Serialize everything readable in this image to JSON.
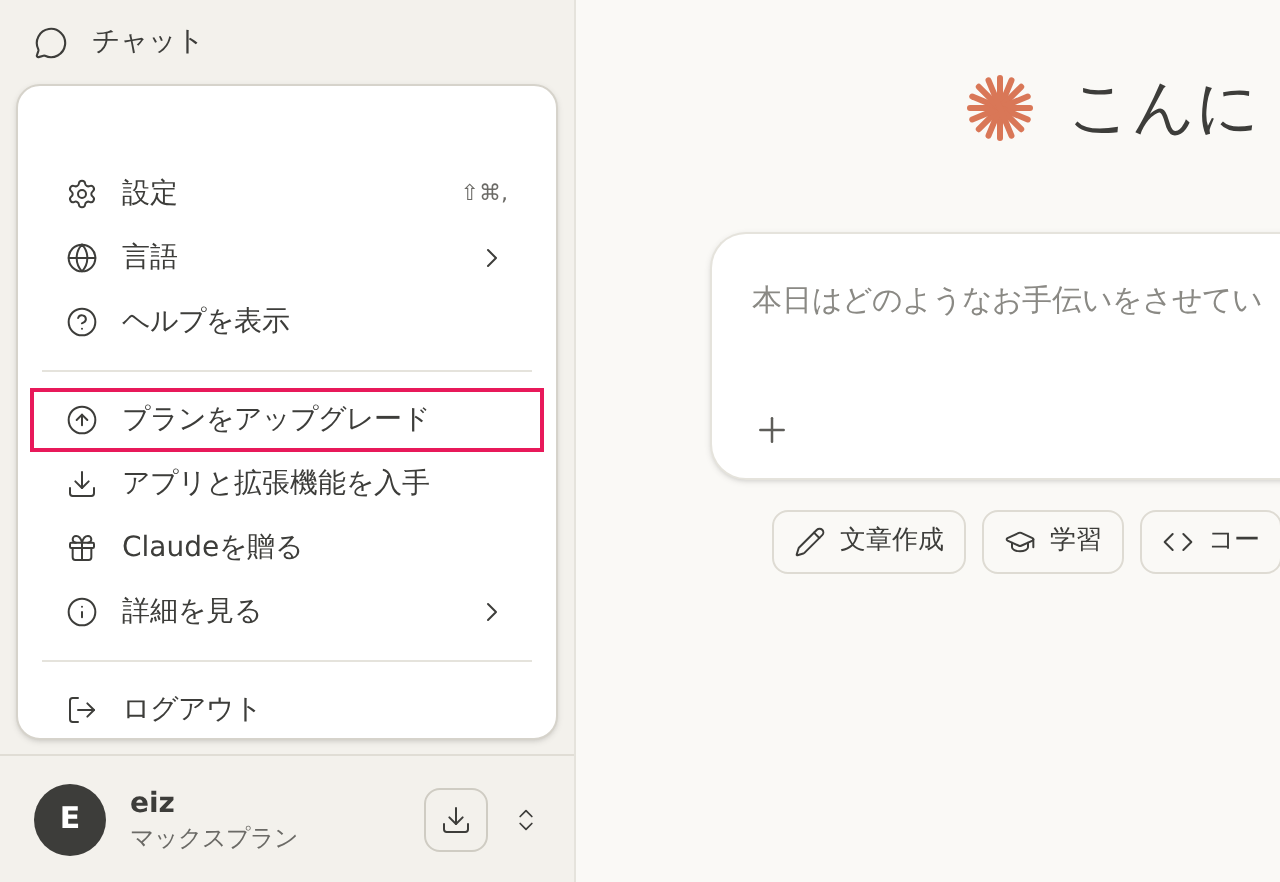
{
  "sidebar": {
    "chat_label": "チャット",
    "menu": [
      {
        "kind": "item",
        "label": "設定",
        "shortcut": "⇧⌘,",
        "highlighted": false
      },
      {
        "kind": "submenu",
        "label": "言語",
        "highlighted": false
      },
      {
        "kind": "item",
        "label": "ヘルプを表示",
        "highlighted": false
      },
      {
        "kind": "divider"
      },
      {
        "kind": "item",
        "label": "プランをアップグレード",
        "highlighted": true
      },
      {
        "kind": "item",
        "label": "アプリと拡張機能を入手",
        "highlighted": false
      },
      {
        "kind": "item",
        "label": "Claudeを贈る",
        "highlighted": false
      },
      {
        "kind": "submenu",
        "label": "詳細を見る",
        "highlighted": false
      },
      {
        "kind": "divider"
      },
      {
        "kind": "item",
        "label": "ログアウト",
        "highlighted": false
      }
    ],
    "user": {
      "initial": "E",
      "name": "eiz",
      "plan": "マックスプラン"
    }
  },
  "main": {
    "greeting": "こんに",
    "prompt": {
      "placeholder": "本日はどのようなお手伝いをさせてい"
    },
    "chips": [
      {
        "label": "文章作成"
      },
      {
        "label": "学習"
      },
      {
        "label": "コー"
      }
    ]
  }
}
